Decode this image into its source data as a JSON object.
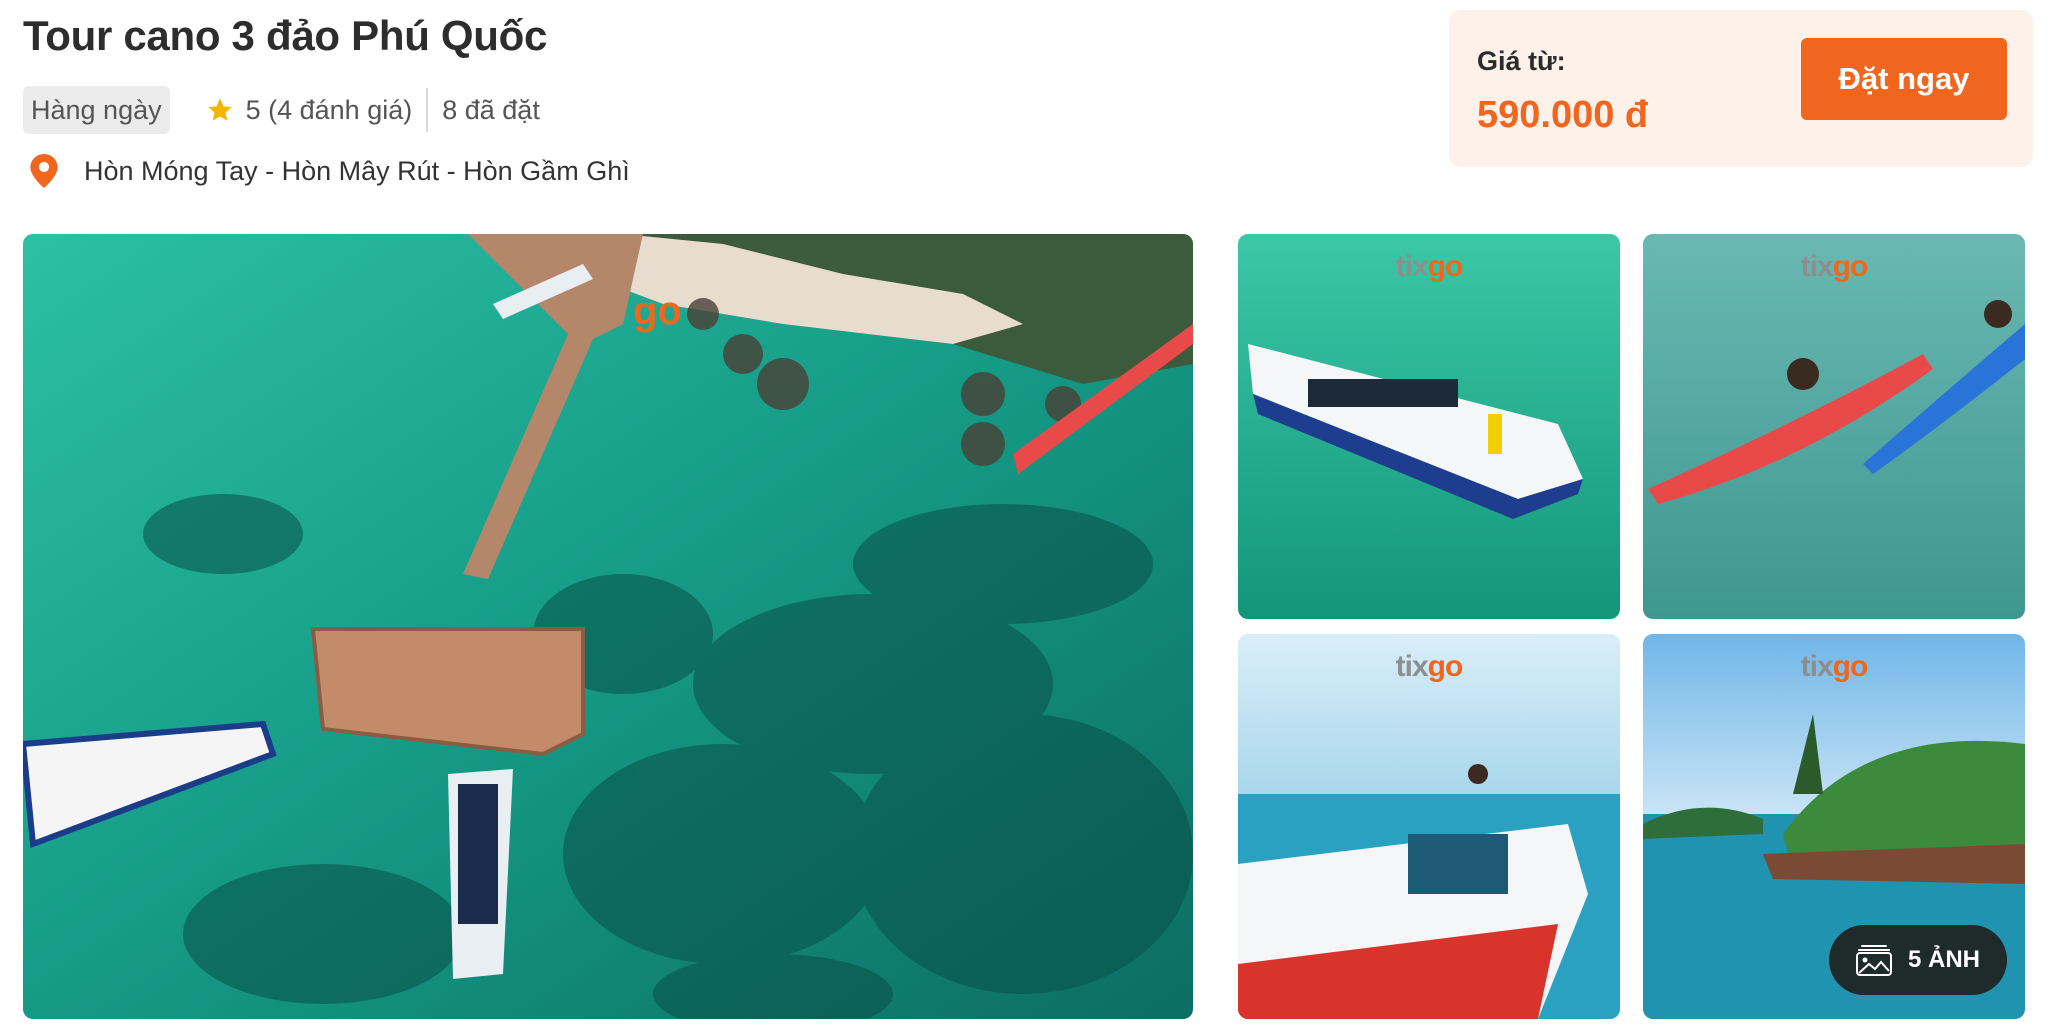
{
  "tour": {
    "title": "Tour cano 3 đảo Phú Quốc",
    "frequency": "Hàng ngày",
    "rating": "5 (4 đánh giá)",
    "booked": "8 đã đặt",
    "location": "Hòn Móng Tay - Hòn Mây Rút - Hòn Gầm Ghì"
  },
  "pricing": {
    "label": "Giá từ:",
    "price": "590.000 đ",
    "book_button": "Đặt ngay"
  },
  "gallery": {
    "watermark_a": "tix",
    "watermark_b": "go",
    "more_photos": "5 ẢNH"
  },
  "colors": {
    "accent": "#f0661f",
    "price_box_bg": "#fdf1e9",
    "star": "#f5b400"
  },
  "icons": [
    "star-icon",
    "location-pin-icon",
    "images-icon"
  ]
}
